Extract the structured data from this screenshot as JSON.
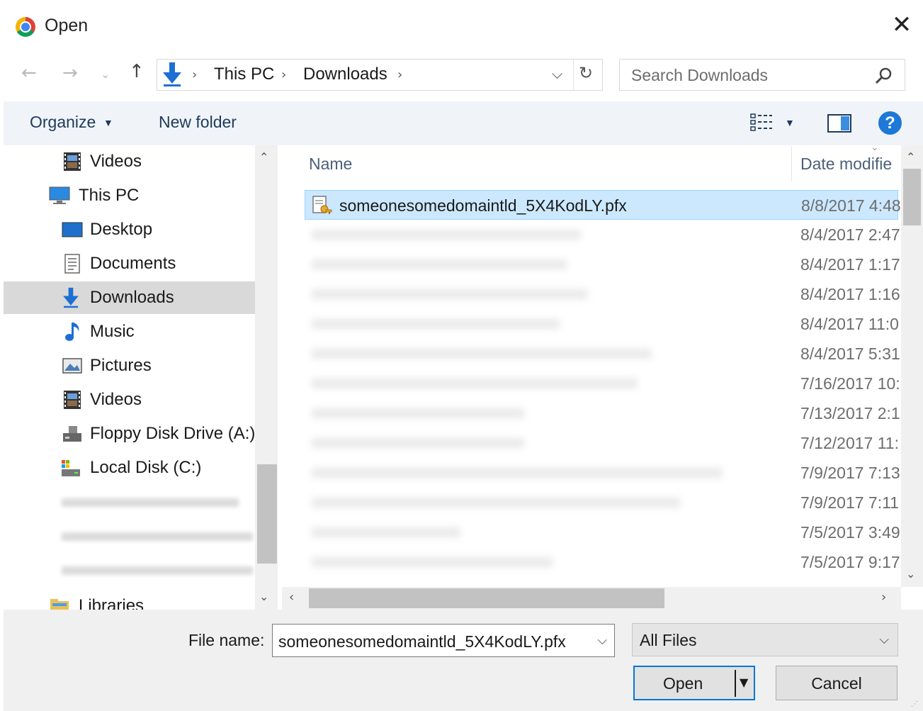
{
  "window": {
    "title": "Open",
    "close_glyph": "✕"
  },
  "nav": {
    "back_glyph": "←",
    "forward_glyph": "→",
    "recent_glyph": "⌄",
    "up_glyph": "↑",
    "crumb_sep": "›",
    "breadcrumbs": [
      "This PC",
      "Downloads"
    ],
    "dropdown_glyph": "⌵",
    "refresh_glyph": "↻"
  },
  "search": {
    "placeholder": "Search Downloads"
  },
  "toolbar": {
    "organize_label": "Organize",
    "new_folder_label": "New folder",
    "caret_glyph": "▼",
    "help_glyph": "?"
  },
  "sidebar": {
    "items": [
      {
        "label": "Videos",
        "icon": "video-icon"
      },
      {
        "label": "This PC",
        "icon": "computer-icon"
      },
      {
        "label": "Desktop",
        "icon": "desktop-icon"
      },
      {
        "label": "Documents",
        "icon": "documents-icon"
      },
      {
        "label": "Downloads",
        "icon": "download-icon",
        "selected": true
      },
      {
        "label": "Music",
        "icon": "music-icon"
      },
      {
        "label": "Pictures",
        "icon": "pictures-icon"
      },
      {
        "label": "Videos",
        "icon": "video-icon"
      },
      {
        "label": "Floppy Disk Drive (A:)",
        "icon": "floppy-icon"
      },
      {
        "label": "Local Disk (C:)",
        "icon": "local-disk-icon"
      },
      {
        "label": "Libraries",
        "icon": "libraries-icon"
      }
    ],
    "scroll_up_glyph": "⌃",
    "scroll_down_glyph": "⌄"
  },
  "file_list": {
    "columns": {
      "name": "Name",
      "date": "Date modifie"
    },
    "sort_glyph": "⌄",
    "rows": [
      {
        "name": "someonesomedomaintld_5X4KodLY.pfx",
        "date": "8/8/2017 4:48",
        "selected": true
      },
      {
        "name": "",
        "date": "8/4/2017 2:47"
      },
      {
        "name": "",
        "date": "8/4/2017 1:17"
      },
      {
        "name": "",
        "date": "8/4/2017 1:16"
      },
      {
        "name": "",
        "date": "8/4/2017 11:0"
      },
      {
        "name": "",
        "date": "8/4/2017 5:31"
      },
      {
        "name": "",
        "date": "7/16/2017 10:"
      },
      {
        "name": "",
        "date": "7/13/2017 2:1"
      },
      {
        "name": "",
        "date": "7/12/2017 11:"
      },
      {
        "name": "",
        "date": "7/9/2017 7:13"
      },
      {
        "name": "",
        "date": "7/9/2017 7:11"
      },
      {
        "name": "",
        "date": "7/5/2017 3:49"
      },
      {
        "name": "",
        "date": "7/5/2017 9:17"
      }
    ],
    "scroll_up_glyph": "⌃",
    "scroll_down_glyph": "⌄",
    "scroll_left_glyph": "‹",
    "scroll_right_glyph": "›"
  },
  "footer": {
    "file_name_label": "File name:",
    "file_name_value": "someonesomedomaintld_5X4KodLY.pfx",
    "dropdown_glyph": "⌵",
    "file_type": "All Files",
    "open_label": "Open",
    "open_caret_glyph": "▼",
    "cancel_label": "Cancel",
    "grip_glyph": "⋰"
  },
  "colors": {
    "accent": "#0078d7",
    "selection_bg": "#cce8ff",
    "toolbar_bg": "#f0f4f9"
  }
}
